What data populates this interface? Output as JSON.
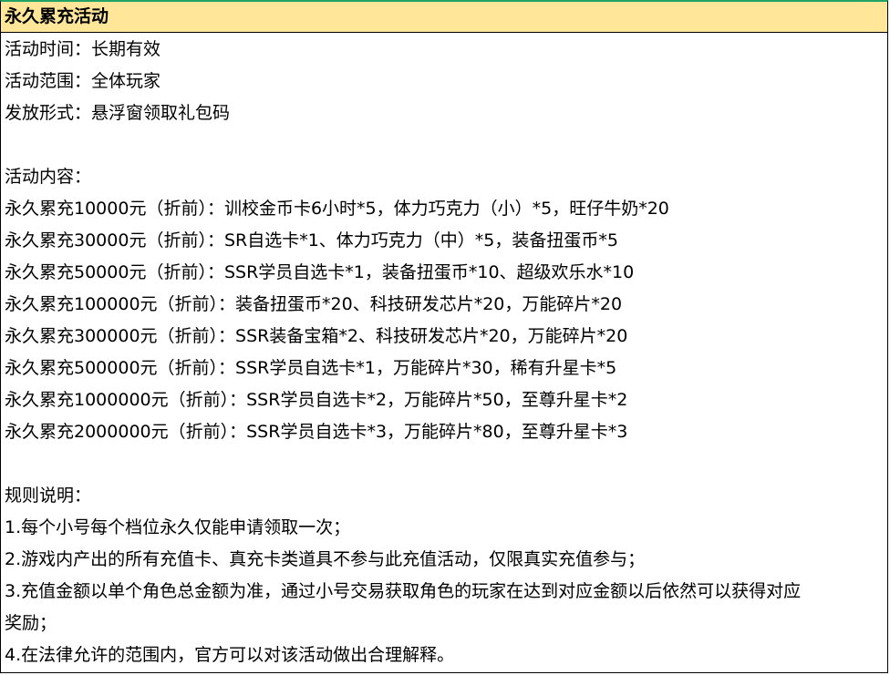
{
  "title": "永久累充活动",
  "info": {
    "time": "活动时间：长期有效",
    "scope": "活动范围：全体玩家",
    "delivery": "发放形式：悬浮窗领取礼包码"
  },
  "content_heading": "活动内容：",
  "tiers": [
    "永久累充10000元（折前）：训校金币卡6小时*5，体力巧克力（小）*5，旺仔牛奶*20",
    "永久累充30000元（折前）：SR自选卡*1、体力巧克力（中）*5，装备扭蛋币*5",
    "永久累充50000元（折前）：SSR学员自选卡*1，装备扭蛋币*10、超级欢乐水*10",
    "永久累充100000元（折前）：装备扭蛋币*20、科技研发芯片*20，万能碎片*20",
    "永久累充300000元（折前）：SSR装备宝箱*2、科技研发芯片*20，万能碎片*20",
    "永久累充500000元（折前）：SSR学员自选卡*1，万能碎片*30，稀有升星卡*5",
    "永久累充1000000元（折前）：SSR学员自选卡*2，万能碎片*50，至尊升星卡*2",
    "永久累充2000000元（折前）：SSR学员自选卡*3，万能碎片*80，至尊升星卡*3"
  ],
  "rules_heading": "规则说明：",
  "rules": [
    "1.每个小号每个档位永久仅能申请领取一次；",
    "2.游戏内产出的所有充值卡、真充卡类道具不参与此充值活动，仅限真实充值参与；",
    "3.充值金额以单个角色总金额为准，通过小号交易获取角色的玩家在达到对应金额以后依然可以获得对应",
    "奖励；",
    "4.在法律允许的范围内，官方可以对该活动做出合理解释。"
  ]
}
